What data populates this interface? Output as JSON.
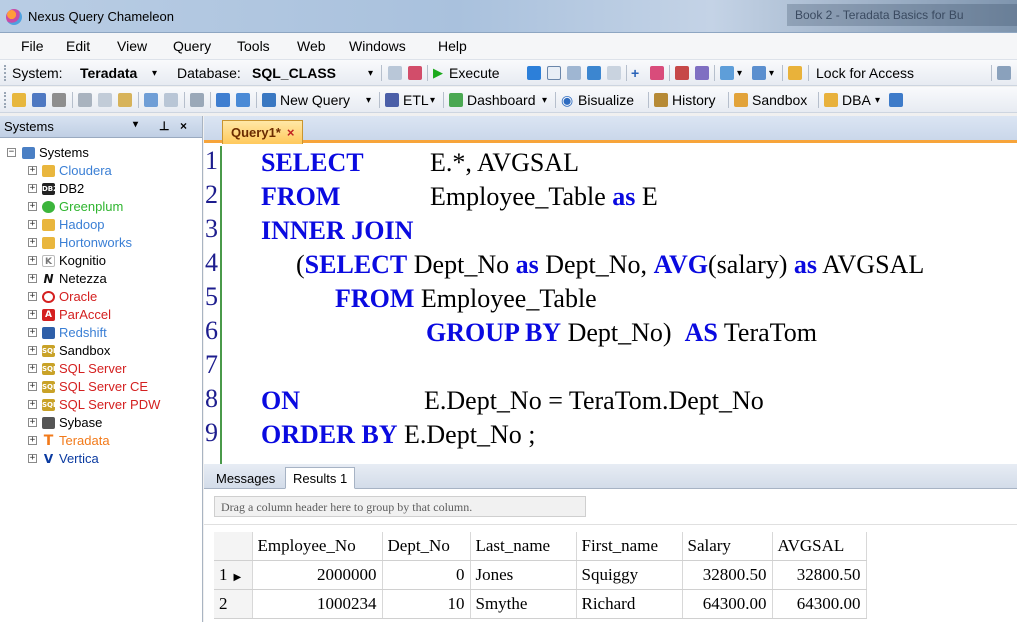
{
  "window": {
    "title": "Nexus Query Chameleon",
    "tab_hint": "Book 2 - Teradata Basics for Bu"
  },
  "menu": [
    "File",
    "Edit",
    "View",
    "Query",
    "Tools",
    "Web",
    "Windows",
    "Help"
  ],
  "toolbar1": {
    "system_label": "System:",
    "system_value": "Teradata",
    "database_label": "Database:",
    "database_value": "SQL_CLASS",
    "execute_label": "Execute",
    "lock_access_label": "Lock for Access"
  },
  "toolbar2": {
    "new_query_label": "New Query",
    "etl_label": "ETL",
    "dashboard_label": "Dashboard",
    "bisualize_label": "Bisualize",
    "history_label": "History",
    "sandbox_label": "Sandbox",
    "dba_label": "DBA"
  },
  "sidebar": {
    "title": "Systems",
    "pin": "↓ 1",
    "close": "×",
    "root": "Systems",
    "items": [
      {
        "label": "Cloudera",
        "color": "#3a7fd5"
      },
      {
        "label": "DB2",
        "color": "#000000"
      },
      {
        "label": "Greenplum",
        "color": "#2fb52f"
      },
      {
        "label": "Hadoop",
        "color": "#3a7fd5"
      },
      {
        "label": "Hortonworks",
        "color": "#3a7fd5"
      },
      {
        "label": "Kognitio",
        "color": "#000000"
      },
      {
        "label": "Netezza",
        "color": "#000000"
      },
      {
        "label": "Oracle",
        "color": "#d42020"
      },
      {
        "label": "ParAccel",
        "color": "#d42020"
      },
      {
        "label": "Redshift",
        "color": "#3a7fd5"
      },
      {
        "label": "Sandbox",
        "color": "#000000"
      },
      {
        "label": "SQL Server",
        "color": "#d42020"
      },
      {
        "label": "SQL Server CE",
        "color": "#d42020"
      },
      {
        "label": "SQL Server PDW",
        "color": "#d42020"
      },
      {
        "label": "Sybase",
        "color": "#000000"
      },
      {
        "label": "Teradata",
        "color": "#f27a1a"
      },
      {
        "label": "Vertica",
        "color": "#0a3aa0"
      }
    ]
  },
  "editor": {
    "tab_label": "Query1*",
    "tab_close": "×",
    "line_numbers": [
      "1",
      "2",
      "3",
      "4",
      "5",
      "6",
      "7",
      "8",
      "9"
    ],
    "code": {
      "l1_kw": "SELECT",
      "l1_txt": "E.*, AVGSAL",
      "l2_kw": "FROM",
      "l2_txt": "Employee_Table",
      "l2_kw2": "as",
      "l2_txt2": "E",
      "l3_kw": "INNER JOIN",
      "l4_open": "(",
      "l4_kw": "SELECT",
      "l4_txt": "Dept_No",
      "l4_as1": "as",
      "l4_txt2": "Dept_No,",
      "l4_avg": "AVG",
      "l4_txt3": "(salary)",
      "l4_as2": "as",
      "l4_txt4": "AVGSAL",
      "l5_kw": "FROM",
      "l5_txt": "Employee_Table",
      "l6_kw": "GROUP BY",
      "l6_txt": "Dept_No)",
      "l6_kw2": "AS",
      "l6_txt2": "TeraTom",
      "l8_kw": "ON",
      "l8_txt": "E.Dept_No = TeraTom.Dept_No",
      "l9_kw": "ORDER BY",
      "l9_txt": "E.Dept_No ;"
    }
  },
  "results": {
    "tabs": [
      "Messages",
      "Results 1"
    ],
    "group_hint": "Drag a column header here to group by that column.",
    "columns": [
      "Employee_No",
      "Dept_No",
      "Last_name",
      "First_name",
      "Salary",
      "AVGSAL"
    ],
    "rows": [
      {
        "n": "1",
        "cells": [
          "2000000",
          "0",
          "Jones",
          "Squiggy",
          "32800.50",
          "32800.50"
        ]
      },
      {
        "n": "2",
        "cells": [
          "1000234",
          "10",
          "Smythe",
          "Richard",
          "64300.00",
          "64300.00"
        ]
      }
    ]
  }
}
